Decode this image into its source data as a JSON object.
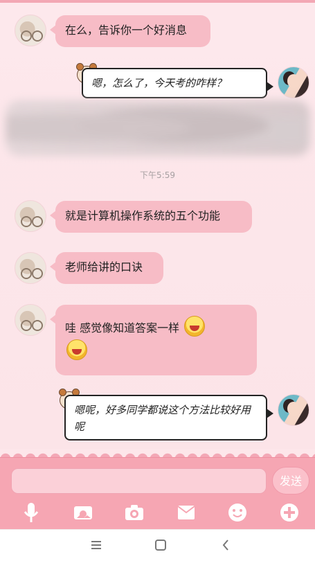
{
  "messages": [
    {
      "text": "在么，告诉你一个好消息"
    },
    {
      "text": "嗯，怎么了，今天考的咋样？"
    },
    {
      "text": "就是计算机操作系统的五个功能"
    },
    {
      "text": "老师给讲的口诀"
    },
    {
      "text": "哇  感觉像知道答案一样"
    },
    {
      "text": "嗯呢，好多同学都说这个方法比较好用呢"
    }
  ],
  "timestamp": "下午5:59",
  "composer": {
    "input_placeholder": "",
    "send_label": "发送"
  },
  "toolbar": {
    "icons": [
      "microphone-icon",
      "image-icon",
      "camera-icon",
      "envelope-icon",
      "smiley-icon",
      "plus-icon"
    ]
  },
  "navigation": {
    "icons": [
      "menu-icon",
      "home-icon",
      "back-icon"
    ]
  },
  "colors": {
    "accent": "#f6a6b3",
    "bubble": "#f7bcc6",
    "background": "#fde6ea"
  }
}
